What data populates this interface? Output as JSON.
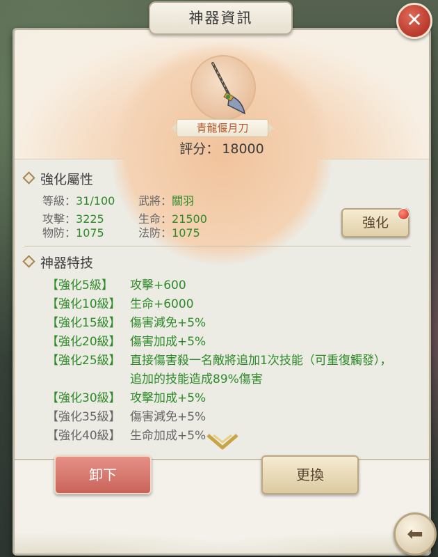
{
  "dialog": {
    "title": "神器資訊"
  },
  "item": {
    "name": "青龍偃月刀",
    "score_label": "評分：",
    "score_value": "18000"
  },
  "attributes": {
    "section_title": "強化屬性",
    "level_label": "等級：",
    "level_value": "31/100",
    "general_label": "武將：",
    "general_value": "關羽",
    "attack_label": "攻擊：",
    "attack_value": "3225",
    "hp_label": "生命：",
    "hp_value": "21500",
    "pdef_label": "物防：",
    "pdef_value": "1075",
    "mdef_label": "法防：",
    "mdef_value": "1075",
    "strengthen_button": "強化"
  },
  "skills": {
    "section_title": "神器特技",
    "rows": [
      {
        "level": "【強化5級】",
        "effect": "攻擊+600",
        "active": true
      },
      {
        "level": "【強化10級】",
        "effect": "生命+6000",
        "active": true
      },
      {
        "level": "【強化15級】",
        "effect": "傷害減免+5%",
        "active": true
      },
      {
        "level": "【強化20級】",
        "effect": "傷害加成+5%",
        "active": true
      },
      {
        "level": "【強化25級】",
        "effect": "直接傷害殺一名敵將追加1次技能（可重復觸發），追加的技能造成89%傷害",
        "active": true
      },
      {
        "level": "【強化30級】",
        "effect": "攻擊加成+5%",
        "active": true
      },
      {
        "level": "【強化35級】",
        "effect": "傷害減免+5%",
        "active": false
      },
      {
        "level": "【強化40級】",
        "effect": "生命加成+5%",
        "active": false
      }
    ]
  },
  "footer": {
    "unload_button": "卸下",
    "replace_button": "更換"
  },
  "colors": {
    "active": "#2d8a28",
    "inactive": "#666666",
    "accent_red": "#c9635a"
  }
}
